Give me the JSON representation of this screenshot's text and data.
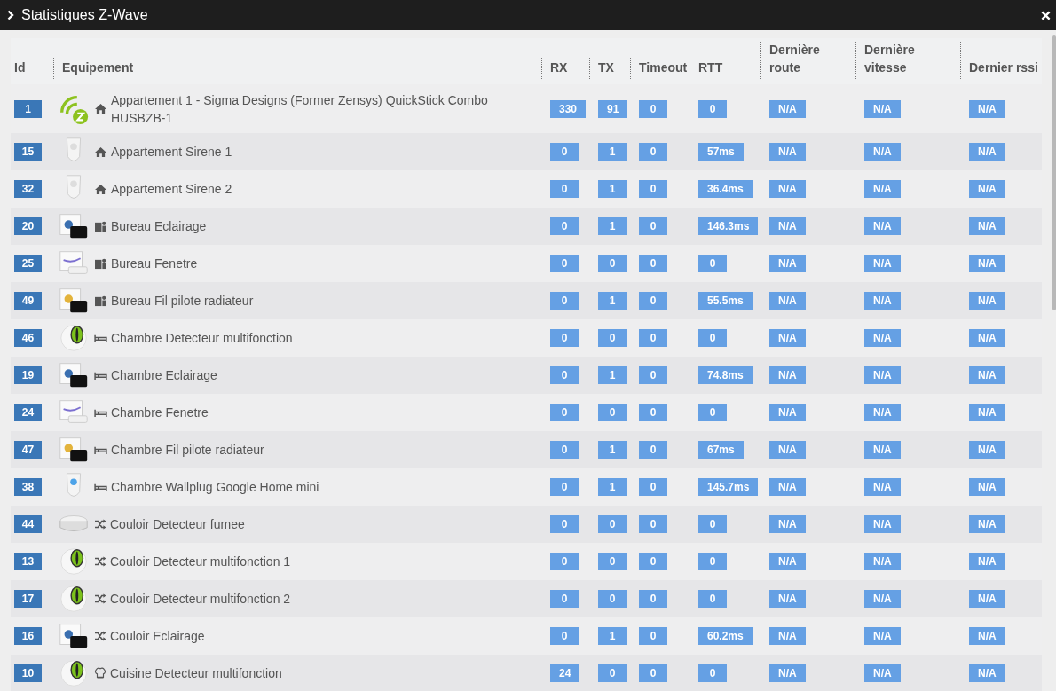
{
  "window": {
    "title": "Statistiques Z-Wave"
  },
  "table": {
    "columns": [
      {
        "label": "Id"
      },
      {
        "label": "Equipement"
      },
      {
        "label": "RX"
      },
      {
        "label": "TX"
      },
      {
        "label": "Timeout"
      },
      {
        "label": "RTT"
      },
      {
        "label": "Dernière route"
      },
      {
        "label": "Dernière vitesse"
      },
      {
        "label": "Dernier rssi"
      }
    ],
    "rows": [
      {
        "id": "1",
        "device_icon": {
          "kind": "zstick"
        },
        "room_icon": {
          "kind": "home"
        },
        "name": "Appartement 1 - Sigma Designs (Former Zensys) QuickStick Combo HUSBZB-1",
        "rx": "330",
        "tx": "91",
        "timeout": "0",
        "rtt": "0",
        "route": "N/A",
        "speed": "N/A",
        "rssi": "N/A"
      },
      {
        "id": "15",
        "device_icon": {
          "kind": "siren"
        },
        "room_icon": {
          "kind": "home"
        },
        "name": "Appartement Sirene 1",
        "rx": "0",
        "tx": "1",
        "timeout": "0",
        "rtt": "57ms",
        "route": "N/A",
        "speed": "N/A",
        "rssi": "N/A"
      },
      {
        "id": "32",
        "device_icon": {
          "kind": "siren"
        },
        "room_icon": {
          "kind": "home"
        },
        "name": "Appartement Sirene 2",
        "rx": "0",
        "tx": "1",
        "timeout": "0",
        "rtt": "36.4ms",
        "route": "N/A",
        "speed": "N/A",
        "rssi": "N/A"
      },
      {
        "id": "20",
        "device_icon": {
          "kind": "dimmer"
        },
        "room_icon": {
          "kind": "office"
        },
        "name": "Bureau Eclairage",
        "rx": "0",
        "tx": "1",
        "timeout": "0",
        "rtt": "146.3ms",
        "route": "N/A",
        "speed": "N/A",
        "rssi": "N/A"
      },
      {
        "id": "25",
        "device_icon": {
          "kind": "door"
        },
        "room_icon": {
          "kind": "office"
        },
        "name": "Bureau Fenetre",
        "rx": "0",
        "tx": "0",
        "timeout": "0",
        "rtt": "0",
        "route": "N/A",
        "speed": "N/A",
        "rssi": "N/A"
      },
      {
        "id": "49",
        "device_icon": {
          "kind": "pilot"
        },
        "room_icon": {
          "kind": "office"
        },
        "name": "Bureau Fil pilote radiateur",
        "rx": "0",
        "tx": "1",
        "timeout": "0",
        "rtt": "55.5ms",
        "route": "N/A",
        "speed": "N/A",
        "rssi": "N/A"
      },
      {
        "id": "46",
        "device_icon": {
          "kind": "eye"
        },
        "room_icon": {
          "kind": "bed"
        },
        "name": "Chambre Detecteur multifonction",
        "rx": "0",
        "tx": "0",
        "timeout": "0",
        "rtt": "0",
        "route": "N/A",
        "speed": "N/A",
        "rssi": "N/A"
      },
      {
        "id": "19",
        "device_icon": {
          "kind": "dimmer"
        },
        "room_icon": {
          "kind": "bed"
        },
        "name": "Chambre Eclairage",
        "rx": "0",
        "tx": "1",
        "timeout": "0",
        "rtt": "74.8ms",
        "route": "N/A",
        "speed": "N/A",
        "rssi": "N/A"
      },
      {
        "id": "24",
        "device_icon": {
          "kind": "door"
        },
        "room_icon": {
          "kind": "bed"
        },
        "name": "Chambre Fenetre",
        "rx": "0",
        "tx": "0",
        "timeout": "0",
        "rtt": "0",
        "route": "N/A",
        "speed": "N/A",
        "rssi": "N/A"
      },
      {
        "id": "47",
        "device_icon": {
          "kind": "pilot"
        },
        "room_icon": {
          "kind": "bed"
        },
        "name": "Chambre Fil pilote radiateur",
        "rx": "0",
        "tx": "1",
        "timeout": "0",
        "rtt": "67ms",
        "route": "N/A",
        "speed": "N/A",
        "rssi": "N/A"
      },
      {
        "id": "38",
        "device_icon": {
          "kind": "wallplug"
        },
        "room_icon": {
          "kind": "bed"
        },
        "name": "Chambre Wallplug Google Home mini",
        "rx": "0",
        "tx": "1",
        "timeout": "0",
        "rtt": "145.7ms",
        "route": "N/A",
        "speed": "N/A",
        "rssi": "N/A"
      },
      {
        "id": "44",
        "device_icon": {
          "kind": "smoke"
        },
        "room_icon": {
          "kind": "shuffle"
        },
        "name": "Couloir Detecteur fumee",
        "rx": "0",
        "tx": "0",
        "timeout": "0",
        "rtt": "0",
        "route": "N/A",
        "speed": "N/A",
        "rssi": "N/A"
      },
      {
        "id": "13",
        "device_icon": {
          "kind": "eye"
        },
        "room_icon": {
          "kind": "shuffle"
        },
        "name": "Couloir Detecteur multifonction 1",
        "rx": "0",
        "tx": "0",
        "timeout": "0",
        "rtt": "0",
        "route": "N/A",
        "speed": "N/A",
        "rssi": "N/A"
      },
      {
        "id": "17",
        "device_icon": {
          "kind": "eye"
        },
        "room_icon": {
          "kind": "shuffle"
        },
        "name": "Couloir Detecteur multifonction 2",
        "rx": "0",
        "tx": "0",
        "timeout": "0",
        "rtt": "0",
        "route": "N/A",
        "speed": "N/A",
        "rssi": "N/A"
      },
      {
        "id": "16",
        "device_icon": {
          "kind": "dimmer"
        },
        "room_icon": {
          "kind": "shuffle"
        },
        "name": "Couloir Eclairage",
        "rx": "0",
        "tx": "1",
        "timeout": "0",
        "rtt": "60.2ms",
        "route": "N/A",
        "speed": "N/A",
        "rssi": "N/A"
      },
      {
        "id": "10",
        "device_icon": {
          "kind": "eye"
        },
        "room_icon": {
          "kind": "chef"
        },
        "name": "Cuisine Detecteur multifonction",
        "rx": "24",
        "tx": "0",
        "timeout": "0",
        "rtt": "0",
        "route": "N/A",
        "speed": "N/A",
        "rssi": "N/A"
      }
    ]
  }
}
